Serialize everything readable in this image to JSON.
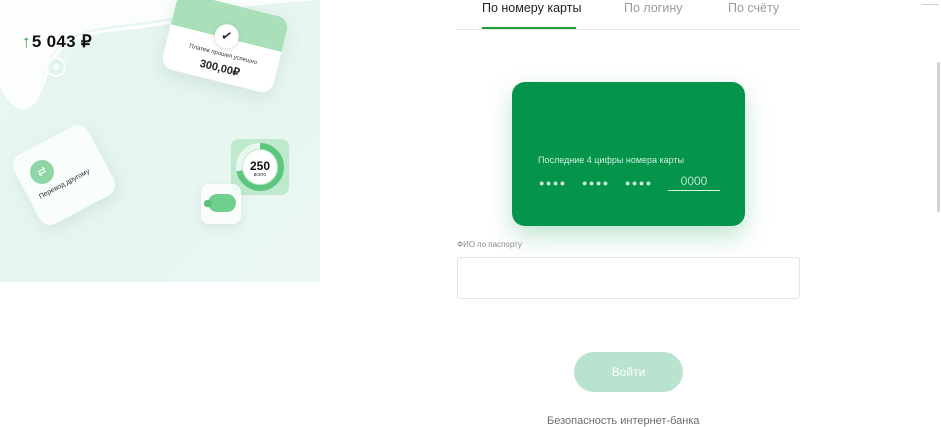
{
  "illustration": {
    "balance": "5 043 ₽",
    "payment_card": {
      "text": "Платеж прошел успешно",
      "amount": "300,00₽"
    },
    "transfer_card": {
      "text": "Перевод другому"
    },
    "ring_card": {
      "value": "250",
      "subtitle": "всего",
      "progress": 0.72
    },
    "colors": {
      "accent": "#21a038",
      "light_green": "#a9e0b9"
    }
  },
  "tabs": [
    {
      "label": "По номеру карты",
      "active": true
    },
    {
      "label": "По логину",
      "active": false
    },
    {
      "label": "По счёту",
      "active": false
    }
  ],
  "card": {
    "label": "Последние 4 цифры номера карты",
    "masked_groups": [
      "●●●●",
      "●●●●",
      "●●●●"
    ],
    "last4_placeholder": "0000",
    "color": "#05944b"
  },
  "fio": {
    "label": "ФИО по паспорту",
    "value": ""
  },
  "login_button": {
    "label": "Войти"
  },
  "security_link": {
    "label": "Безопасность интернет-банка"
  }
}
